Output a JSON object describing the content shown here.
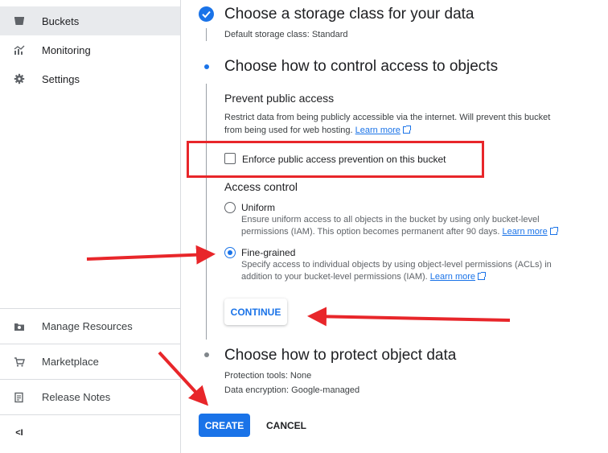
{
  "sidebar": {
    "items": [
      {
        "label": "Buckets",
        "icon": "bucket-icon",
        "active": true
      },
      {
        "label": "Monitoring",
        "icon": "monitoring-chart-icon",
        "active": false
      },
      {
        "label": "Settings",
        "icon": "gear-icon",
        "active": false
      }
    ],
    "bottom_items": [
      {
        "label": "Manage Resources",
        "icon": "manage-resources-icon"
      },
      {
        "label": "Marketplace",
        "icon": "marketplace-cart-icon"
      },
      {
        "label": "Release Notes",
        "icon": "release-notes-icon"
      }
    ],
    "collapse_label": "<I"
  },
  "steps": {
    "storage_class": {
      "title": "Choose a storage class for your data",
      "summary": "Default storage class: Standard"
    },
    "access": {
      "title": "Choose how to control access to objects",
      "prevent_heading": "Prevent public access",
      "prevent_text": "Restrict data from being publicly accessible via the internet. Will prevent this bucket from being used for web hosting.",
      "learn_more": "Learn more",
      "enforce_checkbox_label": "Enforce public access prevention on this bucket",
      "enforce_checked": false,
      "access_control_heading": "Access control",
      "options": [
        {
          "label": "Uniform",
          "description": "Ensure uniform access to all objects in the bucket by using only bucket-level permissions (IAM). This option becomes permanent after 90 days.",
          "selected": false
        },
        {
          "label": "Fine-grained",
          "description": "Specify access to individual objects by using object-level permissions (ACLs) in addition to your bucket-level permissions (IAM).",
          "selected": true
        }
      ],
      "continue_label": "CONTINUE"
    },
    "protect": {
      "title": "Choose how to protect object data",
      "protection_tools": "Protection tools: None",
      "data_encryption": "Data encryption: Google-managed"
    }
  },
  "actions": {
    "create_label": "CREATE",
    "cancel_label": "CANCEL"
  },
  "colors": {
    "accent": "#1a73e8",
    "annotation_red": "#e8262a",
    "active_nav_bg": "#e8eaed"
  }
}
